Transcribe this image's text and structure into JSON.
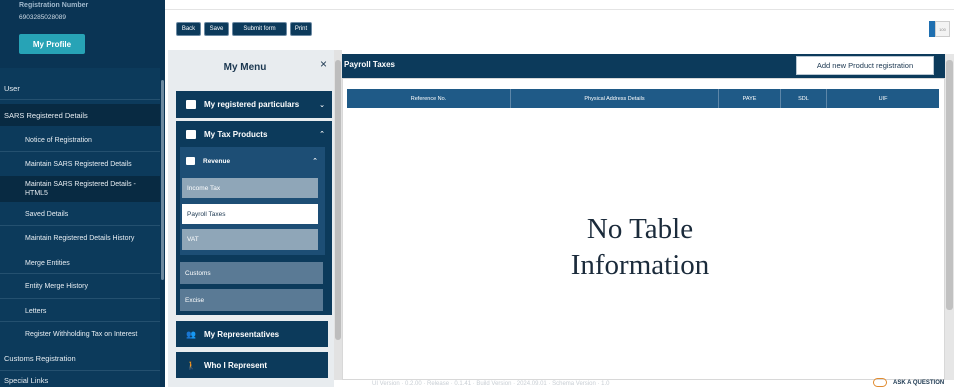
{
  "sidebar": {
    "registration_label": "Registration Number",
    "registration_number": "6903285028089",
    "profile_button": "My Profile",
    "items": [
      {
        "label": "User"
      },
      {
        "label": "SARS Registered Details"
      },
      {
        "label": "Notice of Registration"
      },
      {
        "label": "Maintain SARS Registered Details"
      },
      {
        "label": "Maintain SARS Registered Details - HTML5"
      },
      {
        "label": "Saved Details"
      },
      {
        "label": "Maintain Registered Details History"
      },
      {
        "label": "Merge Entities"
      },
      {
        "label": "Entity Merge History"
      },
      {
        "label": "Letters"
      },
      {
        "label": "Register Withholding Tax on Interest"
      },
      {
        "label": "Customs Registration"
      },
      {
        "label": "Special Links"
      }
    ]
  },
  "toolbar": {
    "back": "Back",
    "save": "Save",
    "submit_form": "Submit form",
    "print": "Print",
    "right_box": "100"
  },
  "menu": {
    "title": "My Menu",
    "close": "×",
    "registered_particulars": "My registered particulars",
    "tax_products": "My Tax Products",
    "revenue": "Revenue",
    "income_tax": "Income Tax",
    "payroll_taxes": "Payroll Taxes",
    "vat": "VAT",
    "customs": "Customs",
    "excise": "Excise",
    "representatives": "My Representatives",
    "who_i_represent": "Who I Represent"
  },
  "payroll": {
    "title": "Payroll Taxes",
    "add_button": "Add new Product registration",
    "columns": [
      "Reference No.",
      "Physical Address Details",
      "PAYE",
      "SDL",
      "UIF"
    ],
    "empty_message_line1": "No Table",
    "empty_message_line2": "Information"
  },
  "footer": {
    "version_text": "UI Version · 0.2.00 · Release · 0.1.41 · Build Version · 2024.09.01 · Schema Version · 1.0",
    "ask": "ASK A QUESTION"
  },
  "colors": {
    "navy": "#0c3a5b",
    "teal_button": "#27a3b6",
    "table_header": "#1f5a87",
    "tax_item": "#8fa6b8"
  }
}
